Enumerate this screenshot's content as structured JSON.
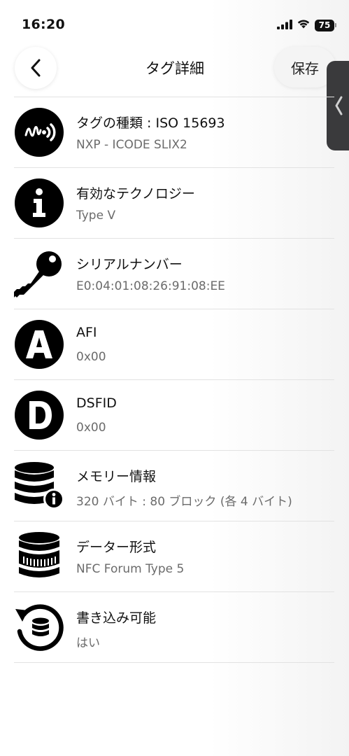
{
  "status_bar": {
    "time": "16:20",
    "battery": "75",
    "icons": [
      "cellular-signal-icon",
      "wifi-icon",
      "battery-icon"
    ]
  },
  "nav": {
    "title": "タグ詳細",
    "save_label": "保存",
    "back_icon": "chevron-left-icon",
    "side_handle_icon": "chevron-left-icon"
  },
  "rows": [
    {
      "icon": "nfc-tag-icon",
      "title": "タグの種類 : ISO 15693",
      "value": "NXP - ICODE SLIX2"
    },
    {
      "icon": "info-icon",
      "title": "有効なテクノロジー",
      "value": "Type V"
    },
    {
      "icon": "key-icon",
      "title": "シリアルナンバー",
      "value": "E0:04:01:08:26:91:08:EE"
    },
    {
      "icon": "letter-a-icon",
      "title": "AFI",
      "value": "0x00"
    },
    {
      "icon": "letter-d-icon",
      "title": "DSFID",
      "value": "0x00"
    },
    {
      "icon": "database-info-icon",
      "title": "メモリー情報",
      "value": "320 バイト : 80 ブロック (各 4 バイト)"
    },
    {
      "icon": "database-format-icon",
      "title": "データー形式",
      "value": "NFC Forum Type 5"
    },
    {
      "icon": "rewrite-database-icon",
      "title": "書き込み可能",
      "value": "はい"
    }
  ],
  "colors": {
    "icon": "#000000",
    "title_text": "#111111",
    "value_text": "#6b6b6b",
    "divider": "#e2e2e2",
    "side_handle": "#3a3a3c"
  }
}
